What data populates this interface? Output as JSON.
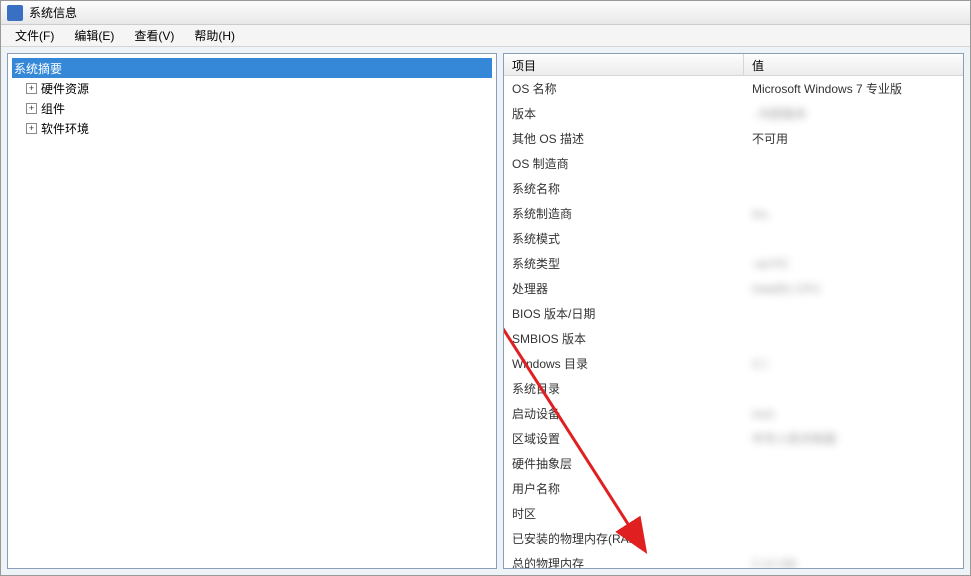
{
  "window": {
    "title": "系统信息"
  },
  "menus": [
    {
      "label": "文件(F)"
    },
    {
      "label": "编辑(E)"
    },
    {
      "label": "查看(V)"
    },
    {
      "label": "帮助(H)"
    }
  ],
  "tree": {
    "root": "系统摘要",
    "children": [
      {
        "label": "硬件资源"
      },
      {
        "label": "组件"
      },
      {
        "label": "软件环境"
      }
    ]
  },
  "detail_header": {
    "col_name": "项目",
    "col_value": "值"
  },
  "detail_rows": [
    {
      "name": "OS 名称",
      "value": "Microsoft Windows 7 专业版",
      "blur": false
    },
    {
      "name": "版本",
      "value": "                           . 内部版本",
      "blur": true
    },
    {
      "name": "其他 OS 描述",
      "value": "不可用",
      "blur": false
    },
    {
      "name": "OS 制造商",
      "value": "",
      "blur": true
    },
    {
      "name": "系统名称",
      "value": "",
      "blur": true
    },
    {
      "name": "系统制造商",
      "value": "              Inc.",
      "blur": true
    },
    {
      "name": "系统模式",
      "value": "",
      "blur": true
    },
    {
      "name": "系统类型",
      "value": "              -ed PC",
      "blur": true
    },
    {
      "name": "处理器",
      "value": "Intel(R)                         CPU",
      "blur": true
    },
    {
      "name": "BIOS 版本/日期",
      "value": "",
      "blur": true
    },
    {
      "name": "SMBIOS 版本",
      "value": "",
      "blur": true
    },
    {
      "name": "Windows 目录",
      "value": "C:\\",
      "blur": true
    },
    {
      "name": "系统目录",
      "value": "",
      "blur": true
    },
    {
      "name": "启动设备",
      "value": "                              me1",
      "blur": true
    },
    {
      "name": "区域设置",
      "value": "中华人民共和国",
      "blur": true
    },
    {
      "name": "硬件抽象层",
      "value": "",
      "blur": true
    },
    {
      "name": "用户名称",
      "value": "",
      "blur": true
    },
    {
      "name": "时区",
      "value": "",
      "blur": false
    },
    {
      "name": "已安装的物理内存(RAM)",
      "value": "",
      "blur": false
    },
    {
      "name": "总的物理内存",
      "value": "2.12 GB",
      "blur": true
    }
  ]
}
